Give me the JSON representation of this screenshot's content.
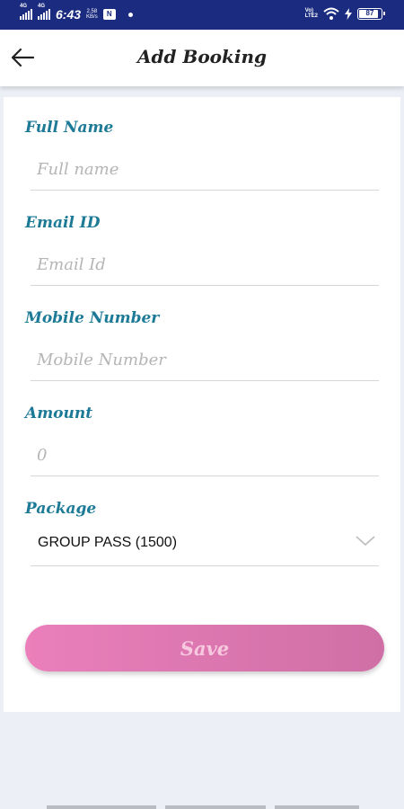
{
  "status_bar": {
    "signal1_tag": "4G",
    "signal2_tag": "4G",
    "time": "6:43",
    "speed_value": "2.58",
    "speed_unit": "KB/s",
    "app_badge": "N",
    "volte_top": "Vo)",
    "volte_bottom": "LTE2",
    "battery_level": "87",
    "battery_fraction": 0.87
  },
  "app_bar": {
    "back_icon": "arrow-left-icon",
    "title": "Add Booking"
  },
  "form": {
    "full_name": {
      "label": "Full Name",
      "placeholder": "Full name",
      "value": ""
    },
    "email": {
      "label": "Email ID",
      "placeholder": "Email Id",
      "value": ""
    },
    "mobile": {
      "label": "Mobile Number",
      "placeholder": "Mobile Number",
      "value": ""
    },
    "amount": {
      "label": "Amount",
      "placeholder": "0",
      "value": ""
    },
    "package": {
      "label": "Package",
      "selected": "GROUP PASS (1500)",
      "icon": "chevron-down-icon"
    },
    "save_label": "Save"
  },
  "colors": {
    "status_bar": "#1a2b80",
    "label": "#1d7a97",
    "save_gradient_start": "#ea7fbb",
    "save_gradient_end": "#cf6fa6",
    "save_text": "#f6c9df",
    "background": "#eceff5"
  }
}
